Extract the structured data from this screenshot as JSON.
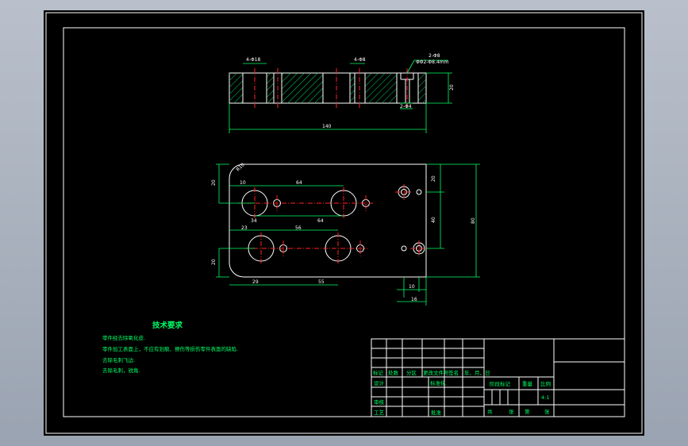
{
  "colors": {
    "background": "#000000",
    "outline": "#ffffff",
    "dimension": "#00ff66",
    "centerline": "#ff2020",
    "hatch": "#00cc66",
    "frame_bg": "#a7aebb"
  },
  "drawing": {
    "top_view": {
      "hole_callout_left": "4-Φ18",
      "hole_callout_mid": "4-Φ8",
      "counterbore_callout_1": "2-Φ8",
      "counterbore_callout_2": "ΦΦ2-Φ8.4mm",
      "small_hole_callout": "2-Φ4",
      "height": "20",
      "length": "140"
    },
    "plan_view": {
      "corner_radius": "R10",
      "dim_left_top": "20",
      "dim_first_offset": "10",
      "dim_spacing_top": "64",
      "dim_bore_offset_top": "34",
      "dim_spacing_mid": "64",
      "dim_second_offset": "23",
      "dim_spacing_row2": "56",
      "dim_left_bottom": "20",
      "dim_bottom_offset": "29",
      "dim_bottom_spacing": "55",
      "dim_right_top": "20",
      "dim_right_mid": "40",
      "dim_right_overall": "80",
      "dim_below_10": "10",
      "dim_below_16": "16"
    },
    "tech_requirements": {
      "title": "技术要求",
      "lines": [
        "零件经去除氧化皮.",
        "零件加工表面上，不应有划痕、擦伤等损伤零件表面的缺陷.",
        "去除毛刺飞边.",
        "去除毛刺，锐角."
      ]
    },
    "title_block": {
      "col_marks": "标记",
      "col_count": "处数",
      "col_zone": "分区",
      "col_change_doc": "更改文件号",
      "col_signature": "签名",
      "col_date": "年、月、日",
      "row_design": "设计",
      "row_standard": "标准化",
      "row_review": "审核",
      "row_process": "工艺",
      "row_approve": "批准",
      "stage_mark": "阶段标记",
      "weight": "重量",
      "scale": "比例",
      "scale_value": "4:1",
      "sheets_total": "共",
      "sheets_label": "张",
      "sheet_no": "第",
      "sheet_label": "张"
    }
  }
}
